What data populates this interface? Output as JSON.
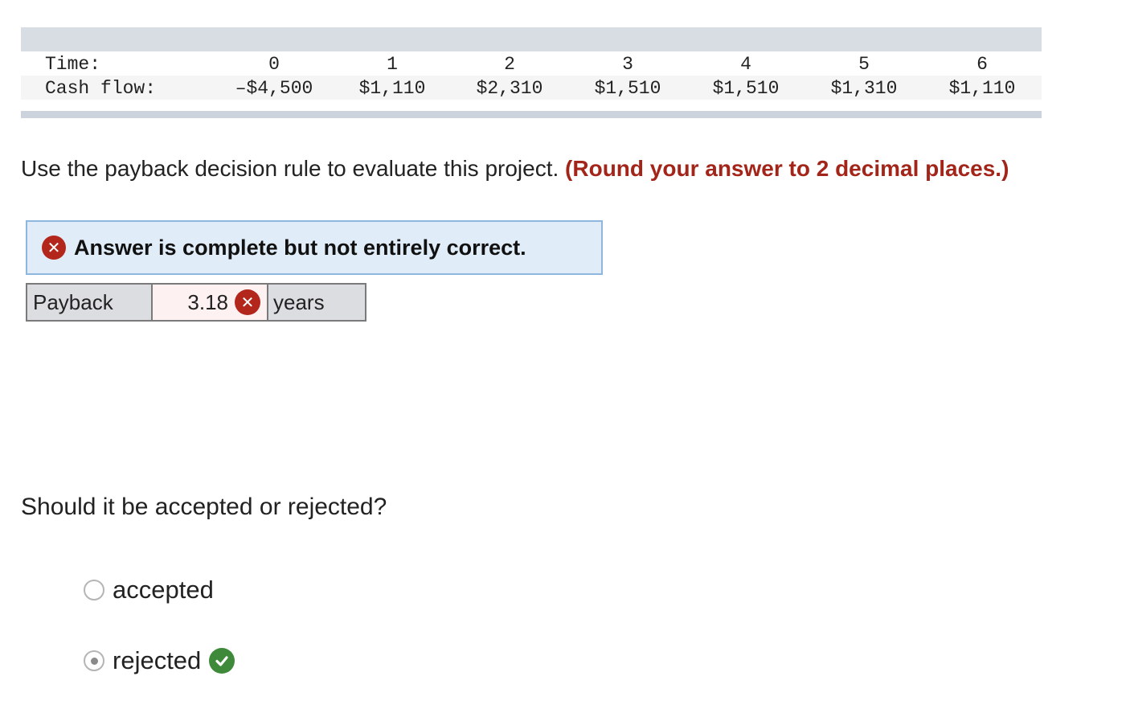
{
  "cash_flow_table": {
    "time_label": "Time:",
    "cash_flow_label": "Cash flow:",
    "periods": [
      "0",
      "1",
      "2",
      "3",
      "4",
      "5",
      "6"
    ],
    "cash_flows": [
      "–$4,500",
      "$1,110",
      "$2,310",
      "$1,510",
      "$1,510",
      "$1,310",
      "$1,110"
    ]
  },
  "question": {
    "text": "Use the payback decision rule to evaluate this project.",
    "hint": "(Round your answer to 2 decimal places.)"
  },
  "feedback": {
    "message": "Answer is complete but not entirely correct.",
    "icon": "x-circle-icon"
  },
  "answer": {
    "label": "Payback",
    "value": "3.18",
    "unit": "years",
    "status": "incorrect"
  },
  "question2": {
    "text": "Should it be accepted or rejected?"
  },
  "options": [
    {
      "label": "accepted",
      "selected": false
    },
    {
      "label": "rejected",
      "selected": true,
      "status": "correct"
    }
  ],
  "colors": {
    "error_red": "#b3261c",
    "hint_red": "#a3251a",
    "correct_green": "#3f8a3a",
    "banner_bg": "#e0ecf7",
    "banner_border": "#8fb6de"
  }
}
